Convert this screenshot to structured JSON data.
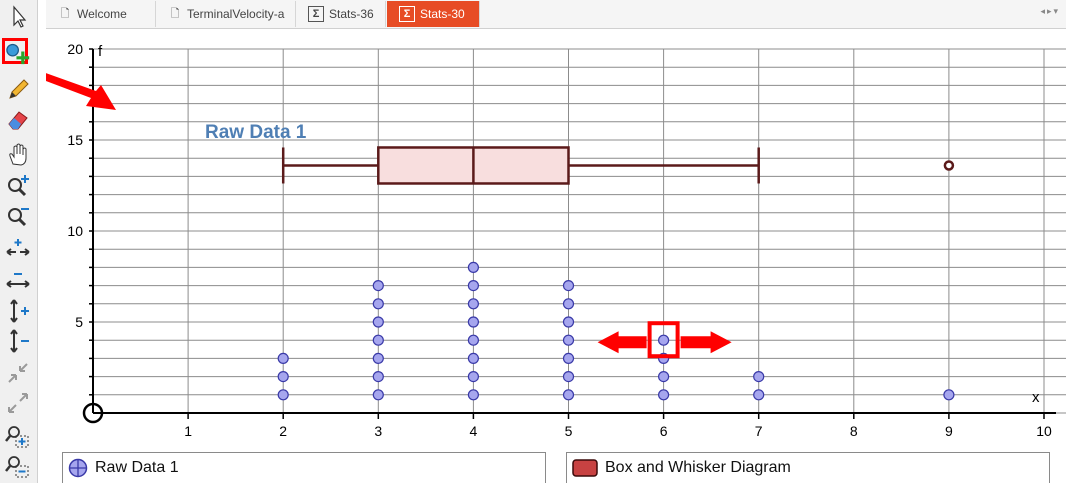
{
  "tabs": [
    {
      "label": "Welcome",
      "icon": "document-icon"
    },
    {
      "label": "TerminalVelocity-a",
      "icon": "document-icon"
    },
    {
      "label": "Stats-36",
      "icon": "sigma-icon"
    },
    {
      "label": "Stats-30",
      "icon": "sigma-icon"
    }
  ],
  "active_tab": "Stats-30",
  "toolbar": [
    "pointer-icon",
    "add-data-icon",
    "pencil-icon",
    "eraser-icon",
    "hand-icon",
    "zoom-in-icon",
    "zoom-out-icon",
    "expand-x-icon",
    "compress-x-icon",
    "expand-y-icon",
    "compress-y-icon",
    "shrink-diagonal-icon",
    "expand-diagonal-icon",
    "zoom-box-in-icon",
    "zoom-box-out-icon"
  ],
  "chart_data": {
    "type": "scatter",
    "x_axis": {
      "label": "x",
      "range": [
        0,
        10
      ],
      "ticks": [
        "1",
        "2",
        "3",
        "4",
        "5",
        "6",
        "7",
        "8",
        "9",
        "10"
      ]
    },
    "y_axis": {
      "label": "f",
      "range": [
        0,
        20
      ],
      "ticks": [
        "5",
        "10",
        "15",
        "20"
      ]
    },
    "grid": true,
    "annotation": "Raw Data 1",
    "dot_plot": {
      "name": "Raw Data 1",
      "x": [
        2,
        2,
        2,
        3,
        3,
        3,
        3,
        3,
        3,
        3,
        4,
        4,
        4,
        4,
        4,
        4,
        4,
        4,
        5,
        5,
        5,
        5,
        5,
        5,
        5,
        6,
        6,
        6,
        6,
        7,
        7,
        9
      ],
      "y": [
        1,
        2,
        3,
        1,
        2,
        3,
        4,
        5,
        6,
        7,
        1,
        2,
        3,
        4,
        5,
        6,
        7,
        8,
        1,
        2,
        3,
        4,
        5,
        6,
        7,
        1,
        2,
        3,
        4,
        1,
        2,
        1
      ]
    },
    "box_plot": {
      "name": "Box and Whisker Diagram",
      "min": 2,
      "q1": 3,
      "median": 4,
      "q3": 5,
      "max": 7,
      "outliers": [
        9
      ]
    },
    "highlighted_point": {
      "x": 6,
      "y": 4
    }
  },
  "legend": {
    "item1": "Raw Data 1",
    "item2": "Box and Whisker Diagram"
  },
  "colors": {
    "dot_fill": "#a6a6ee",
    "dot_stroke": "#3a3aa8",
    "box_stroke": "#5b1a1a",
    "box_fill": "#f8dede",
    "annotation": "#4f7fb4",
    "callout": "#ff0000",
    "active_tab": "#e74c25"
  }
}
